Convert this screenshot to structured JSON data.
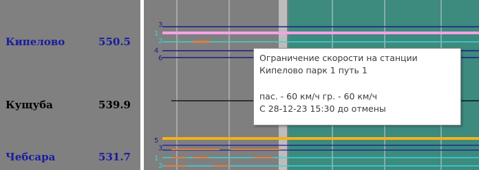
{
  "stations": [
    {
      "name": "Кипелово",
      "km": "550.5",
      "name_color": "#1a1aa0"
    },
    {
      "name": "Кущуба",
      "km": "539.9",
      "name_color": "#000000"
    },
    {
      "name": "Чебсара",
      "km": "531.7",
      "name_color": "#1a1aa0"
    }
  ],
  "track_labels": {
    "kipelovo": [
      "3",
      "1",
      "2",
      "4",
      "6"
    ],
    "chebsara": [
      "5",
      "3",
      "1",
      "2"
    ]
  },
  "tooltip": {
    "line1": "Ограничение скорости на станции",
    "line2": "Кипелово   парк 1 путь 1",
    "line3": "пас. - 60 км/ч гр. - 60 км/ч",
    "line4": "С 28-12-23 15:30 до отмены"
  },
  "colors": {
    "panel_bg": "#808080",
    "restricted_zone": "#3d8a7f",
    "track_main": "#1b1b8c",
    "track_side": "#3ad6d6",
    "track_highlight": "#f4a3e4",
    "track_yellow": "#f2b21b",
    "track_orange": "#e08040"
  }
}
